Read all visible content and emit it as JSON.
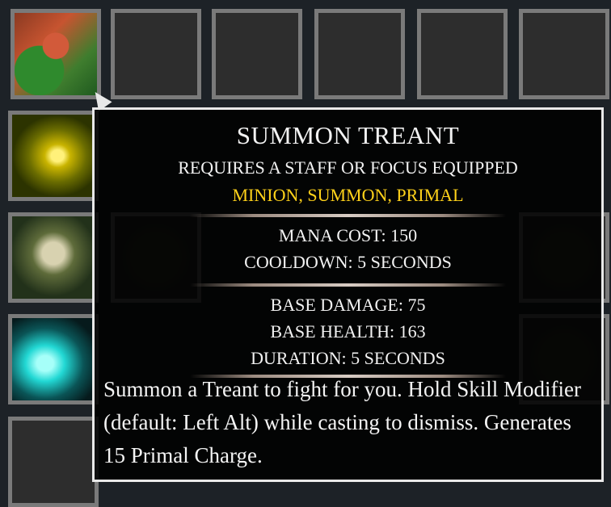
{
  "grid": {
    "slots": [
      {
        "icon": "treant-portrait-icon"
      },
      {
        "icon": "empty"
      },
      {
        "icon": "empty"
      },
      {
        "icon": "empty"
      },
      {
        "icon": "empty"
      },
      {
        "icon": "empty"
      },
      {
        "icon": "yellow-swirl-icon"
      },
      {
        "icon": "armored-summon-icon"
      },
      {
        "icon": "cyan-slash-icon"
      },
      {
        "icon": "empty"
      }
    ]
  },
  "tooltip": {
    "title": "SUMMON TREANT",
    "requirement": "REQUIRES A STAFF OR FOCUS EQUIPPED",
    "tags": "MINION, SUMMON, PRIMAL",
    "tag_color": "#ffd21a",
    "costs": [
      "MANA COST: 150",
      "COOLDOWN: 5 SECONDS"
    ],
    "stats": [
      "BASE DAMAGE: 75",
      "BASE HEALTH: 163",
      "DURATION: 5 SECONDS"
    ],
    "description": "Summon a Treant to fight for you. Hold Skill Modifier (default: Left Alt) while casting to dismiss. Generates 15 Primal Charge."
  }
}
